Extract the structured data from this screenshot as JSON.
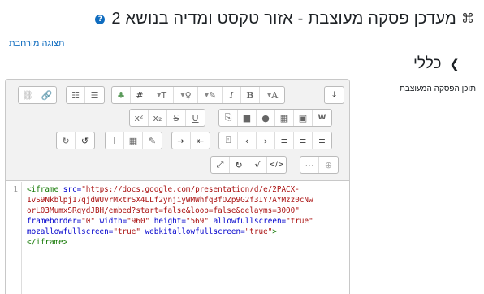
{
  "header": {
    "title": "מעדכן פסקה מעוצבת - אזור טקסט ומדיה בנושא 2",
    "title_icon": "module-icon",
    "help_icon": "?"
  },
  "expand_link": "תצוגה מורחבת",
  "section": {
    "title": "כללי",
    "chevron": "⌄"
  },
  "field": {
    "label": "תוכן הפסקה המעוצבת"
  },
  "editor": {
    "line_number": "1",
    "code_lines": [
      [
        {
          "c": "tag",
          "t": "<iframe"
        },
        {
          "c": "",
          "t": " "
        },
        {
          "c": "attr",
          "t": "src="
        },
        {
          "c": "str",
          "t": "\"https://docs.google.com/presentation/d/e/2PACX-"
        }
      ],
      [
        {
          "c": "str",
          "t": "1vS9Nkblpj17qjdWUvrMxtrSX4LLf2ynjiyWMWhfq3fOZp9G2f3IY7AYMzz0cNw"
        }
      ],
      [
        {
          "c": "str",
          "t": "orL03MumxSRgydJBH/embed?start=false&loop=false&delayms=3000\""
        }
      ],
      [
        {
          "c": "attr",
          "t": "frameborder="
        },
        {
          "c": "str",
          "t": "\"0\""
        },
        {
          "c": "",
          "t": " "
        },
        {
          "c": "attr",
          "t": "width="
        },
        {
          "c": "str",
          "t": "\"960\""
        },
        {
          "c": "",
          "t": " "
        },
        {
          "c": "attr",
          "t": "height="
        },
        {
          "c": "str",
          "t": "\"569\""
        },
        {
          "c": "",
          "t": " "
        },
        {
          "c": "attr",
          "t": "allowfullscreen="
        },
        {
          "c": "str",
          "t": "\"true\""
        }
      ],
      [
        {
          "c": "attr",
          "t": "mozallowfullscreen="
        },
        {
          "c": "str",
          "t": "\"true\""
        },
        {
          "c": "",
          "t": " "
        },
        {
          "c": "attr",
          "t": "webkitallowfullscreen="
        },
        {
          "c": "str",
          "t": "\"true\""
        },
        {
          "c": "tag",
          "t": ">"
        }
      ],
      [
        {
          "c": "tag",
          "t": "</iframe>"
        }
      ]
    ]
  },
  "toolbar": {
    "icons": {
      "unlink": "⛓",
      "link": "🔗",
      "ordered_list": "☷",
      "bullet_list": "☰",
      "accessibility": "♣",
      "hash": "#",
      "style": "T",
      "lightbulb": "♀",
      "brush": "✎",
      "italic": "I",
      "bold": "B",
      "font": "A",
      "toggle": "⤓",
      "superscript": "x²",
      "subscript": "x₂",
      "strike": "S",
      "underline": "U",
      "copy": "⎘",
      "video": "■",
      "mic": "●",
      "gallery": "▦",
      "image": "▣",
      "word": "W",
      "redo": "↻",
      "undo": "↺",
      "cursor": "I",
      "table": "▦",
      "edit": "✎",
      "indent": "⇥",
      "outdent": "⇤",
      "special": "⍞",
      "prev": "‹",
      "next": "›",
      "align_right": "≡",
      "align_center": "≡",
      "align_left": "≡",
      "fullscreen": "⤢",
      "refresh": "↻",
      "math": "√",
      "html": "</>",
      "grid": "⋯",
      "help": "⊕"
    }
  }
}
